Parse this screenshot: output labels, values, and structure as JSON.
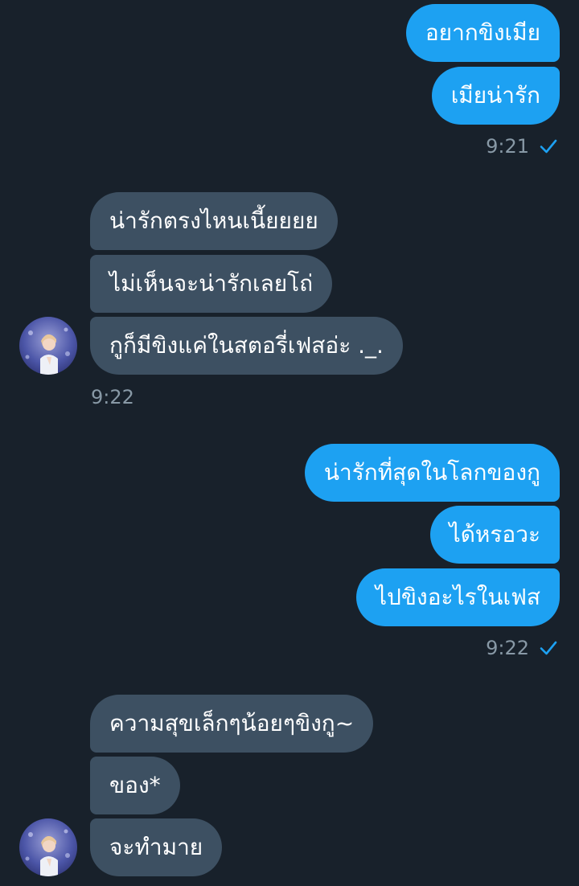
{
  "messages": {
    "group1": {
      "items": [
        "อยากขิงเมีย",
        "เมียน่ารัก"
      ],
      "time": "9:21"
    },
    "group2": {
      "items": [
        "น่ารักตรงไหนเนี้ยยยย",
        "ไม่เห็นจะน่ารักเลยโถ่",
        "กูก็มีขิงแค่ในสตอรี่เฟสอ่ะ ._."
      ],
      "time": "9:22"
    },
    "group3": {
      "items": [
        "น่ารักที่สุดในโลกของกู",
        "ได้หรอวะ",
        "ไปขิงอะไรในเฟส"
      ],
      "time": "9:22"
    },
    "group4": {
      "items": [
        "ความสุขเล็กๆน้อยๆขิงกู~",
        "ของ*",
        "จะทำมาย"
      ]
    }
  },
  "colors": {
    "background": "#18212b",
    "sent_bubble": "#1da1f2",
    "received_bubble": "#3d5062",
    "timestamp": "#8899a6",
    "read_check": "#1da1f2"
  },
  "icons": {
    "read_receipt": "check-icon",
    "avatar": "avatar"
  }
}
